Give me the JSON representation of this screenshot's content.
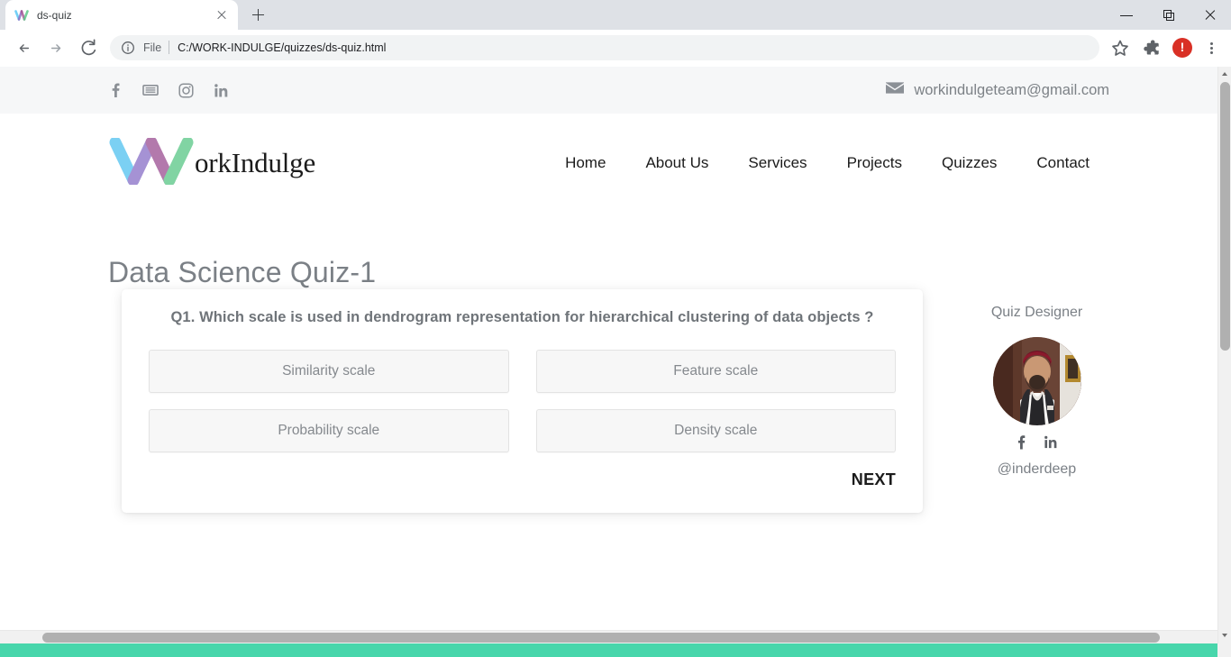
{
  "browser": {
    "tab": {
      "title": "ds-quiz",
      "favicon_icon": "workindulge-w-favicon",
      "close_icon": "close-icon"
    },
    "newtab_icon": "plus-icon",
    "window": {
      "minimize_icon": "minimize-icon",
      "maximize_icon": "maximize-icon",
      "close_icon": "window-close-icon"
    },
    "nav": {
      "back_icon": "arrow-back-icon",
      "forward_icon": "arrow-forward-icon",
      "reload_icon": "reload-icon"
    },
    "omnibox": {
      "info_icon": "info-circle-icon",
      "scheme_label": "File",
      "url": "C:/WORK-INDULGE/quizzes/ds-quiz.html"
    },
    "actions": {
      "bookmark_icon": "star-icon",
      "extensions_icon": "puzzle-piece-icon",
      "profile_icon": "profile-avatar-alert",
      "menu_icon": "three-dot-menu-icon"
    }
  },
  "site": {
    "topbar": {
      "socials": [
        {
          "name": "facebook",
          "glyph": "f"
        },
        {
          "name": "youtube",
          "glyph": "youtube"
        },
        {
          "name": "instagram",
          "glyph": "instagram"
        },
        {
          "name": "linkedin",
          "glyph": "in"
        }
      ],
      "email_icon": "envelope-icon",
      "email": "workindulgeteam@gmail.com"
    },
    "logo": {
      "mark_icon": "workindulge-w-logo",
      "word": "orkIndulge"
    },
    "nav": [
      {
        "label": "Home"
      },
      {
        "label": "About Us"
      },
      {
        "label": "Services"
      },
      {
        "label": "Projects"
      },
      {
        "label": "Quizzes"
      },
      {
        "label": "Contact"
      }
    ],
    "footer_color": "#48d6ab"
  },
  "quiz": {
    "title": "Data Science Quiz-1",
    "question_number": "Q1.",
    "question": "Q1. Which scale is used in dendrogram representation for hierarchical clustering of data objects ?",
    "options": [
      {
        "label": "Similarity scale"
      },
      {
        "label": "Feature scale"
      },
      {
        "label": "Probability scale"
      },
      {
        "label": "Density scale"
      }
    ],
    "next_label": "NEXT"
  },
  "designer": {
    "title": "Quiz Designer",
    "avatar_icon": "designer-photo-avatar",
    "socials": [
      {
        "name": "facebook",
        "glyph": "f"
      },
      {
        "name": "linkedin",
        "glyph": "in"
      }
    ],
    "handle": "@inderdeep"
  },
  "colors": {
    "topbar_bg": "#f6f7f8",
    "accent_teal": "#48d6ab",
    "text_gray": "#7b8086",
    "option_bg": "#f7f7f7"
  }
}
